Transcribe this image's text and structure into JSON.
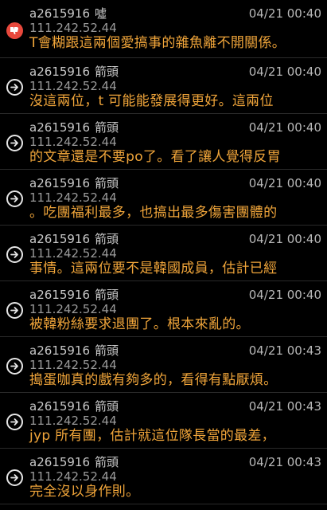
{
  "comments": [
    {
      "icon": "boo-icon",
      "user": "a2615916",
      "tag": "噓",
      "ip": "111.242.52.44",
      "time": "04/21 00:40",
      "text": "T會糊跟這兩個愛搞事的雜魚離不開關係。"
    },
    {
      "icon": "push-arrow-icon",
      "user": "a2615916",
      "tag": "箭頭",
      "ip": "111.242.52.44",
      "time": "04/21 00:40",
      "text": "沒這兩位，t 可能能發展得更好。這兩位"
    },
    {
      "icon": "push-arrow-icon",
      "user": "a2615916",
      "tag": "箭頭",
      "ip": "111.242.52.44",
      "time": "04/21 00:40",
      "text": "的文章還是不要po了。看了讓人覺得反胃"
    },
    {
      "icon": "push-arrow-icon",
      "user": "a2615916",
      "tag": "箭頭",
      "ip": "111.242.52.44",
      "time": "04/21 00:40",
      "text": "。吃團福利最多，也搞出最多傷害團體的"
    },
    {
      "icon": "push-arrow-icon",
      "user": "a2615916",
      "tag": "箭頭",
      "ip": "111.242.52.44",
      "time": "04/21 00:40",
      "text": "事情。這兩位要不是韓國成員，估計已經"
    },
    {
      "icon": "push-arrow-icon",
      "user": "a2615916",
      "tag": "箭頭",
      "ip": "111.242.52.44",
      "time": "04/21 00:40",
      "text": "被韓粉絲要求退團了。根本來亂的。"
    },
    {
      "icon": "push-arrow-icon",
      "user": "a2615916",
      "tag": "箭頭",
      "ip": "111.242.52.44",
      "time": "04/21 00:43",
      "text": "搗蛋咖真的戲有夠多的，看得有點厭煩。"
    },
    {
      "icon": "push-arrow-icon",
      "user": "a2615916",
      "tag": "箭頭",
      "ip": "111.242.52.44",
      "time": "04/21 00:43",
      "text": "jyp 所有團，估計就這位隊長當的最差，"
    },
    {
      "icon": "push-arrow-icon",
      "user": "a2615916",
      "tag": "箭頭",
      "ip": "111.242.52.44",
      "time": "04/21 00:43",
      "text": "完全沒以身作則。"
    }
  ]
}
